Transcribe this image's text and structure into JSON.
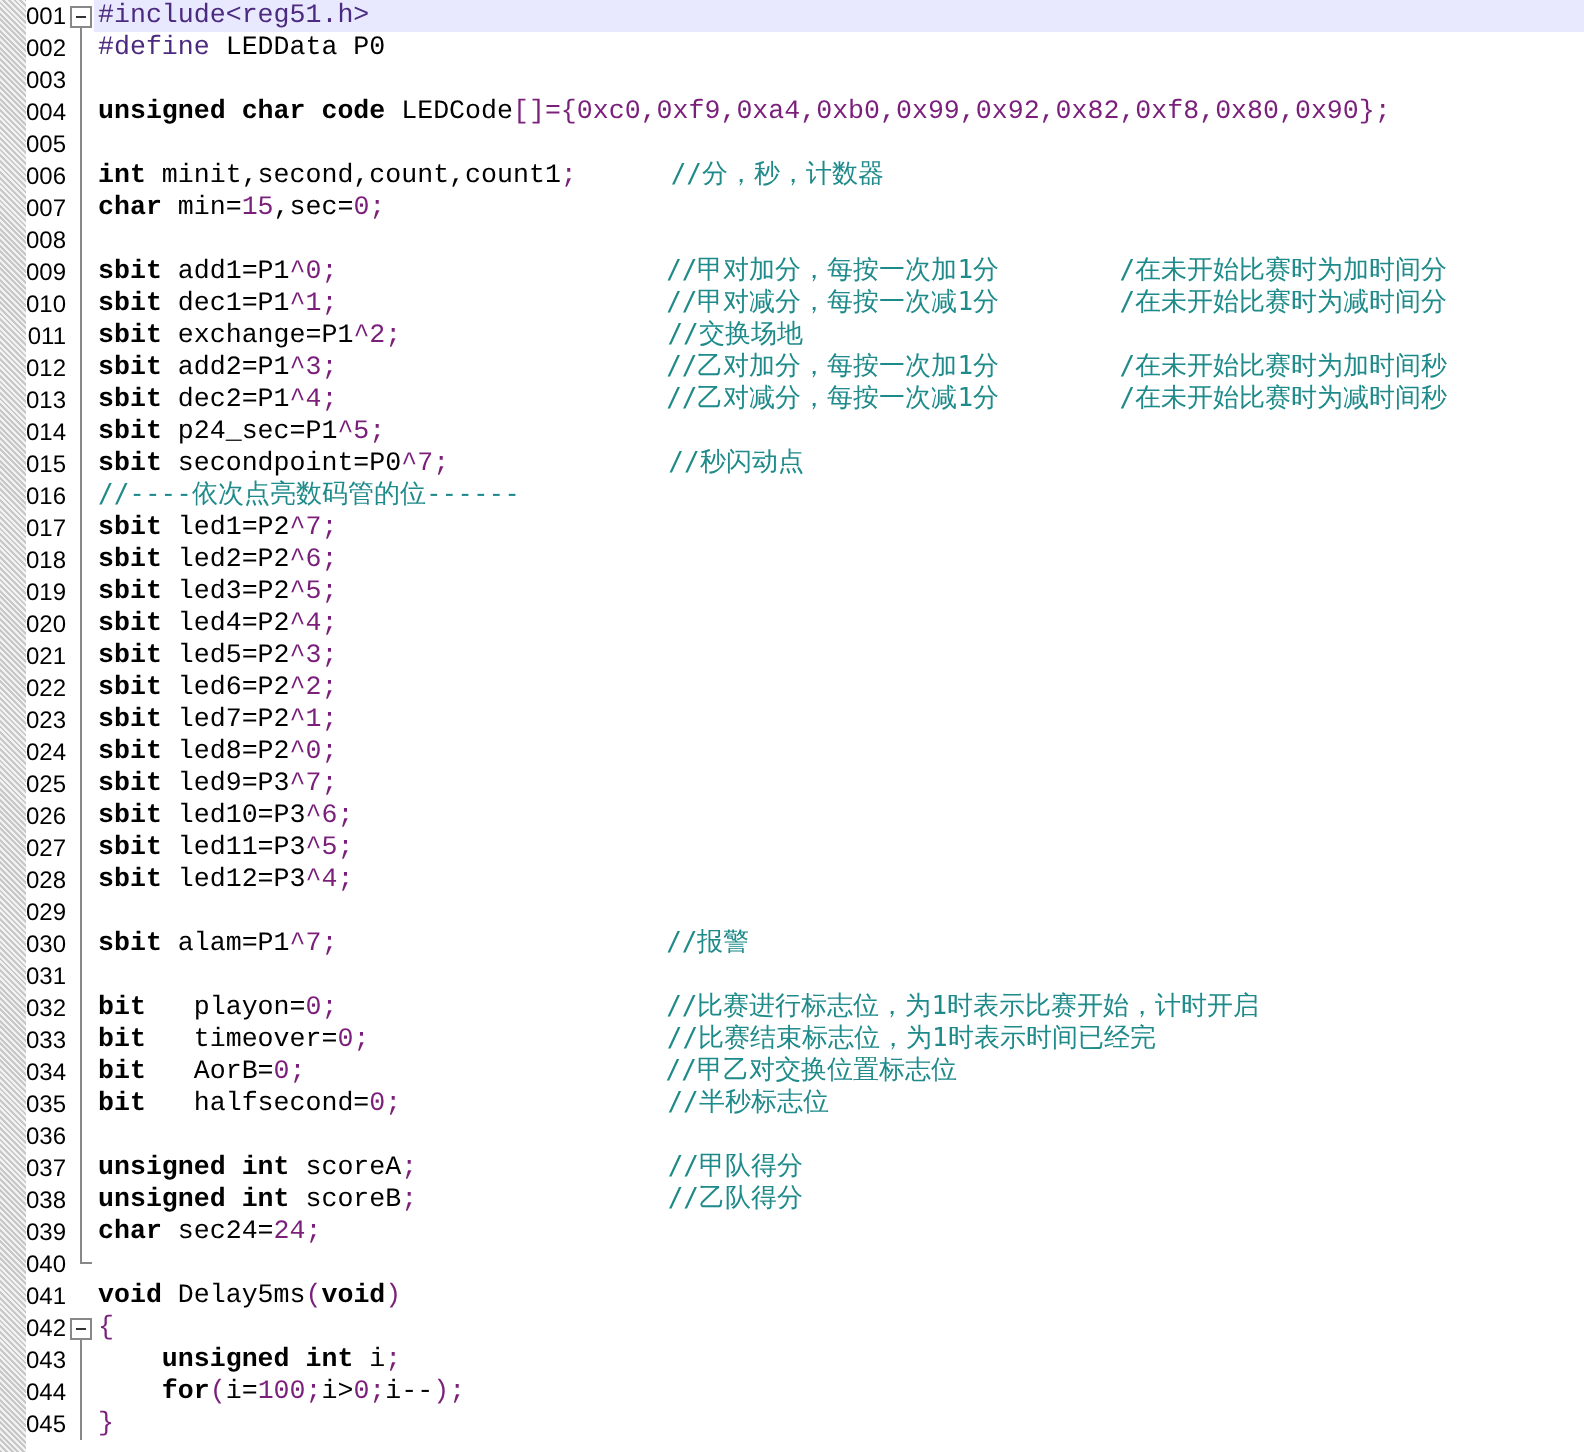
{
  "editor": {
    "lines": [
      {
        "number": "001",
        "current": true,
        "kind": "fold_start",
        "code": [
          {
            "kind": "directive",
            "text": "#include<reg51.h>"
          }
        ]
      },
      {
        "number": "002",
        "current": false,
        "kind": "line",
        "code": [
          {
            "kind": "directive",
            "text": "#define"
          },
          {
            "kind": "plain",
            "text": " LEDData P0"
          }
        ]
      },
      {
        "number": "003",
        "current": false,
        "kind": "line"
      },
      {
        "number": "004",
        "current": false,
        "kind": "line",
        "code": [
          {
            "kind": "keyword",
            "text": "unsigned char code"
          },
          {
            "kind": "plain",
            "text": " LEDCode"
          },
          {
            "kind": "punct",
            "text": "[]={0xc0,0xf9,0xa4,0xb0,0x99,0x92,0x82,0xf8,0x80,0x90};"
          }
        ]
      },
      {
        "number": "005",
        "current": false,
        "kind": "line"
      },
      {
        "number": "006",
        "current": false,
        "kind": "line",
        "code": [
          {
            "kind": "keyword",
            "text": "int"
          },
          {
            "kind": "plain",
            "text": " minit,second,count,count1"
          },
          {
            "kind": "punct",
            "text": ";"
          }
        ],
        "comments": [
          "//分，秒，计数器"
        ]
      },
      {
        "number": "007",
        "current": false,
        "kind": "line",
        "code": [
          {
            "kind": "keyword",
            "text": "char"
          },
          {
            "kind": "plain",
            "text": " min="
          },
          {
            "kind": "punct",
            "text": "15"
          },
          {
            "kind": "plain",
            "text": ",sec="
          },
          {
            "kind": "punct",
            "text": "0;"
          }
        ]
      },
      {
        "number": "008",
        "current": false,
        "kind": "line"
      },
      {
        "number": "009",
        "current": false,
        "kind": "line",
        "code": [
          {
            "kind": "keyword",
            "text": "sbit"
          },
          {
            "kind": "plain",
            "text": " add1=P1"
          },
          {
            "kind": "punct",
            "text": "^0;"
          }
        ],
        "comments": [
          "//甲对加分，每按一次加1分",
          "/在未开始比赛时为加时间分"
        ]
      },
      {
        "number": "010",
        "current": false,
        "kind": "line",
        "code": [
          {
            "kind": "keyword",
            "text": "sbit"
          },
          {
            "kind": "plain",
            "text": " dec1=P1"
          },
          {
            "kind": "punct",
            "text": "^1;"
          }
        ],
        "comments": [
          "//甲对减分，每按一次减1分",
          "/在未开始比赛时为减时间分"
        ]
      },
      {
        "number": "011",
        "current": false,
        "kind": "line",
        "code": [
          {
            "kind": "keyword",
            "text": "sbit"
          },
          {
            "kind": "plain",
            "text": " exchange=P1"
          },
          {
            "kind": "punct",
            "text": "^2;"
          }
        ],
        "comments": [
          "//交换场地"
        ]
      },
      {
        "number": "012",
        "current": false,
        "kind": "line",
        "code": [
          {
            "kind": "keyword",
            "text": "sbit"
          },
          {
            "kind": "plain",
            "text": " add2=P1"
          },
          {
            "kind": "punct",
            "text": "^3;"
          }
        ],
        "comments": [
          "//乙对加分，每按一次加1分",
          "/在未开始比赛时为加时间秒"
        ]
      },
      {
        "number": "013",
        "current": false,
        "kind": "line",
        "code": [
          {
            "kind": "keyword",
            "text": "sbit"
          },
          {
            "kind": "plain",
            "text": " dec2=P1"
          },
          {
            "kind": "punct",
            "text": "^4;"
          }
        ],
        "comments": [
          "//乙对减分，每按一次减1分",
          "/在未开始比赛时为减时间秒"
        ]
      },
      {
        "number": "014",
        "current": false,
        "kind": "line",
        "code": [
          {
            "kind": "keyword",
            "text": "sbit"
          },
          {
            "kind": "plain",
            "text": " p24_sec=P1"
          },
          {
            "kind": "punct",
            "text": "^5;"
          }
        ]
      },
      {
        "number": "015",
        "current": false,
        "kind": "line",
        "code": [
          {
            "kind": "keyword",
            "text": "sbit"
          },
          {
            "kind": "plain",
            "text": " secondpoint=P0"
          },
          {
            "kind": "punct",
            "text": "^7;"
          }
        ],
        "comments": [
          "//秒闪动点"
        ]
      },
      {
        "number": "016",
        "current": false,
        "kind": "line",
        "comments": [
          "//----依次点亮数码管的位------"
        ]
      },
      {
        "number": "017",
        "current": false,
        "kind": "line",
        "code": [
          {
            "kind": "keyword",
            "text": "sbit"
          },
          {
            "kind": "plain",
            "text": " led1=P2"
          },
          {
            "kind": "punct",
            "text": "^7;"
          }
        ]
      },
      {
        "number": "018",
        "current": false,
        "kind": "line",
        "code": [
          {
            "kind": "keyword",
            "text": "sbit"
          },
          {
            "kind": "plain",
            "text": " led2=P2"
          },
          {
            "kind": "punct",
            "text": "^6;"
          }
        ]
      },
      {
        "number": "019",
        "current": false,
        "kind": "line",
        "code": [
          {
            "kind": "keyword",
            "text": "sbit"
          },
          {
            "kind": "plain",
            "text": " led3=P2"
          },
          {
            "kind": "punct",
            "text": "^5;"
          }
        ]
      },
      {
        "number": "020",
        "current": false,
        "kind": "line",
        "code": [
          {
            "kind": "keyword",
            "text": "sbit"
          },
          {
            "kind": "plain",
            "text": " led4=P2"
          },
          {
            "kind": "punct",
            "text": "^4;"
          }
        ]
      },
      {
        "number": "021",
        "current": false,
        "kind": "line",
        "code": [
          {
            "kind": "keyword",
            "text": "sbit"
          },
          {
            "kind": "plain",
            "text": " led5=P2"
          },
          {
            "kind": "punct",
            "text": "^3;"
          }
        ]
      },
      {
        "number": "022",
        "current": false,
        "kind": "line",
        "code": [
          {
            "kind": "keyword",
            "text": "sbit"
          },
          {
            "kind": "plain",
            "text": " led6=P2"
          },
          {
            "kind": "punct",
            "text": "^2;"
          }
        ]
      },
      {
        "number": "023",
        "current": false,
        "kind": "line",
        "code": [
          {
            "kind": "keyword",
            "text": "sbit"
          },
          {
            "kind": "plain",
            "text": " led7=P2"
          },
          {
            "kind": "punct",
            "text": "^1;"
          }
        ]
      },
      {
        "number": "024",
        "current": false,
        "kind": "line",
        "code": [
          {
            "kind": "keyword",
            "text": "sbit"
          },
          {
            "kind": "plain",
            "text": " led8=P2"
          },
          {
            "kind": "punct",
            "text": "^0;"
          }
        ]
      },
      {
        "number": "025",
        "current": false,
        "kind": "line",
        "code": [
          {
            "kind": "keyword",
            "text": "sbit"
          },
          {
            "kind": "plain",
            "text": " led9=P3"
          },
          {
            "kind": "punct",
            "text": "^7;"
          }
        ]
      },
      {
        "number": "026",
        "current": false,
        "kind": "line",
        "code": [
          {
            "kind": "keyword",
            "text": "sbit"
          },
          {
            "kind": "plain",
            "text": " led10=P3"
          },
          {
            "kind": "punct",
            "text": "^6;"
          }
        ]
      },
      {
        "number": "027",
        "current": false,
        "kind": "line",
        "code": [
          {
            "kind": "keyword",
            "text": "sbit"
          },
          {
            "kind": "plain",
            "text": " led11=P3"
          },
          {
            "kind": "punct",
            "text": "^5;"
          }
        ]
      },
      {
        "number": "028",
        "current": false,
        "kind": "line",
        "code": [
          {
            "kind": "keyword",
            "text": "sbit"
          },
          {
            "kind": "plain",
            "text": " led12=P3"
          },
          {
            "kind": "punct",
            "text": "^4;"
          }
        ]
      },
      {
        "number": "029",
        "current": false,
        "kind": "line"
      },
      {
        "number": "030",
        "current": false,
        "kind": "line",
        "code": [
          {
            "kind": "keyword",
            "text": "sbit"
          },
          {
            "kind": "plain",
            "text": " alam=P1"
          },
          {
            "kind": "punct",
            "text": "^7;"
          }
        ],
        "comments": [
          "//报警"
        ]
      },
      {
        "number": "031",
        "current": false,
        "kind": "line"
      },
      {
        "number": "032",
        "current": false,
        "kind": "line",
        "code": [
          {
            "kind": "keyword",
            "text": "bit"
          },
          {
            "kind": "plain",
            "text": "   playon="
          },
          {
            "kind": "punct",
            "text": "0;"
          }
        ],
        "comments": [
          "//比赛进行标志位，为1时表示比赛开始，计时开启"
        ]
      },
      {
        "number": "033",
        "current": false,
        "kind": "line",
        "code": [
          {
            "kind": "keyword",
            "text": "bit"
          },
          {
            "kind": "plain",
            "text": "   timeover="
          },
          {
            "kind": "punct",
            "text": "0;"
          }
        ],
        "comments": [
          "//比赛结束标志位，为1时表示时间已经完"
        ]
      },
      {
        "number": "034",
        "current": false,
        "kind": "line",
        "code": [
          {
            "kind": "keyword",
            "text": "bit"
          },
          {
            "kind": "plain",
            "text": "   AorB="
          },
          {
            "kind": "punct",
            "text": "0;"
          }
        ],
        "comments": [
          "//甲乙对交换位置标志位"
        ]
      },
      {
        "number": "035",
        "current": false,
        "kind": "line",
        "code": [
          {
            "kind": "keyword",
            "text": "bit"
          },
          {
            "kind": "plain",
            "text": "   halfsecond="
          },
          {
            "kind": "punct",
            "text": "0;"
          }
        ],
        "comments": [
          "//半秒标志位"
        ]
      },
      {
        "number": "036",
        "current": false,
        "kind": "line"
      },
      {
        "number": "037",
        "current": false,
        "kind": "line",
        "code": [
          {
            "kind": "keyword",
            "text": "unsigned int"
          },
          {
            "kind": "plain",
            "text": " scoreA"
          },
          {
            "kind": "punct",
            "text": ";"
          }
        ],
        "comments": [
          "//甲队得分"
        ]
      },
      {
        "number": "038",
        "current": false,
        "kind": "line",
        "code": [
          {
            "kind": "keyword",
            "text": "unsigned int"
          },
          {
            "kind": "plain",
            "text": " scoreB"
          },
          {
            "kind": "punct",
            "text": ";"
          }
        ],
        "comments": [
          "//乙队得分"
        ]
      },
      {
        "number": "039",
        "current": false,
        "kind": "line",
        "code": [
          {
            "kind": "keyword",
            "text": "char"
          },
          {
            "kind": "plain",
            "text": " sec24="
          },
          {
            "kind": "punct",
            "text": "24;"
          }
        ]
      },
      {
        "number": "040",
        "current": false,
        "kind": "fold_end"
      },
      {
        "number": "041",
        "current": false,
        "kind": "line",
        "code": [
          {
            "kind": "keyword",
            "text": "void"
          },
          {
            "kind": "plain",
            "text": " Delay5ms"
          },
          {
            "kind": "punct",
            "text": "("
          },
          {
            "kind": "keyword",
            "text": "void"
          },
          {
            "kind": "punct",
            "text": ")"
          }
        ]
      },
      {
        "number": "042",
        "current": false,
        "kind": "fold_start",
        "code": [
          {
            "kind": "punct",
            "text": "{"
          }
        ]
      },
      {
        "number": "043",
        "current": false,
        "kind": "line",
        "code": [
          {
            "kind": "keyword",
            "text": "    unsigned int"
          },
          {
            "kind": "plain",
            "text": " i"
          },
          {
            "kind": "punct",
            "text": ";"
          }
        ]
      },
      {
        "number": "044",
        "current": false,
        "kind": "line",
        "code": [
          {
            "kind": "keyword",
            "text": "    for"
          },
          {
            "kind": "punct",
            "text": "("
          },
          {
            "kind": "plain",
            "text": "i="
          },
          {
            "kind": "punct",
            "text": "100;"
          },
          {
            "kind": "plain",
            "text": "i>"
          },
          {
            "kind": "punct",
            "text": "0;"
          },
          {
            "kind": "plain",
            "text": "i--"
          },
          {
            "kind": "punct",
            "text": ");"
          }
        ]
      },
      {
        "number": "045",
        "current": false,
        "kind": "line",
        "code": [
          {
            "kind": "punct",
            "text": "}"
          }
        ]
      }
    ]
  }
}
